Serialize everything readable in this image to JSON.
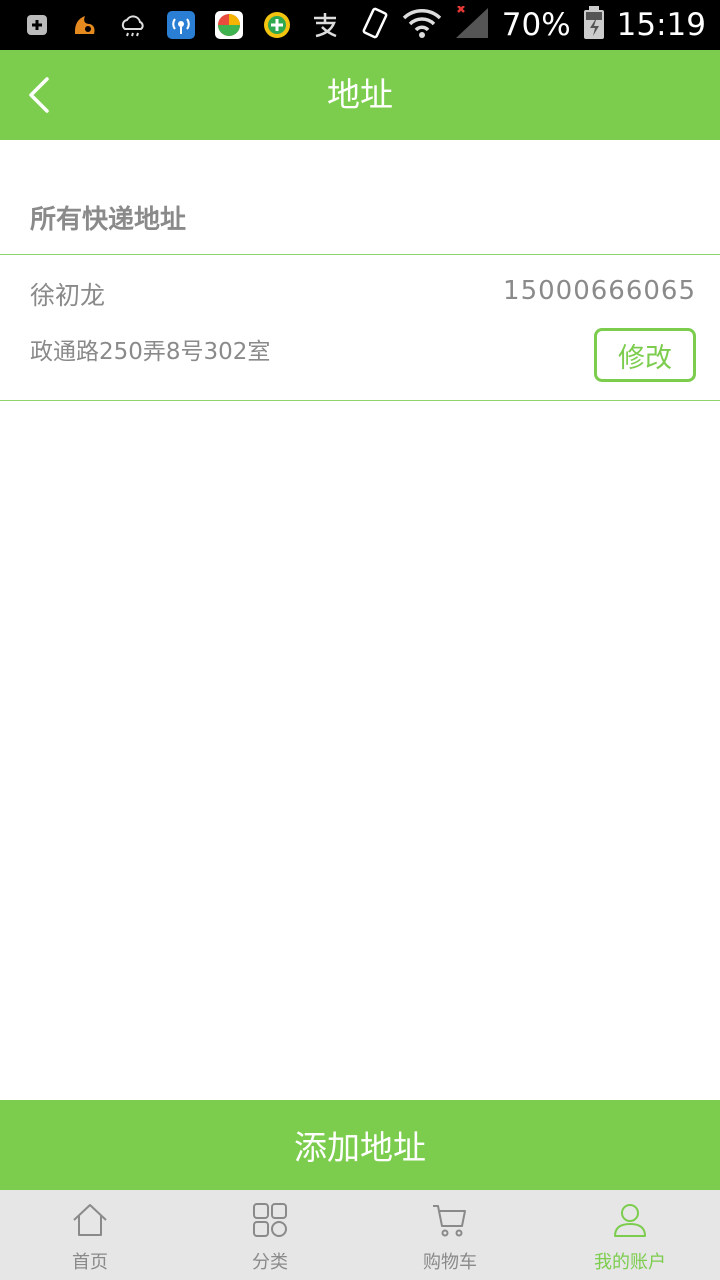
{
  "status_bar": {
    "battery": "70%",
    "time": "15:19",
    "icons": [
      "plus-icon",
      "uc-browser-icon",
      "weather-cloud-icon",
      "wifi-hotspot-icon",
      "app-sphere-icon",
      "add-app-icon",
      "alipay-icon"
    ],
    "right_icons": [
      "vibrate-icon",
      "wifi-icon",
      "signal-icon",
      "battery-icon"
    ]
  },
  "header": {
    "title": "地址",
    "back_icon": "chevron-left-icon"
  },
  "section": {
    "heading": "所有快递地址"
  },
  "addresses": [
    {
      "name": "徐初龙",
      "phone": "15000666065",
      "address": "政通路250弄8号302室",
      "edit_label": "修改"
    }
  ],
  "actions": {
    "add_address": "添加地址"
  },
  "tabbar": {
    "items": [
      {
        "label": "首页",
        "icon": "home-icon"
      },
      {
        "label": "分类",
        "icon": "grid-icon"
      },
      {
        "label": "购物车",
        "icon": "cart-icon"
      },
      {
        "label": "我的账户",
        "icon": "user-icon"
      }
    ],
    "active_index": 3
  },
  "colors": {
    "accent": "#7ccd4e",
    "text_gray": "#8a8a8a",
    "tab_bg": "#e6e6e6"
  }
}
